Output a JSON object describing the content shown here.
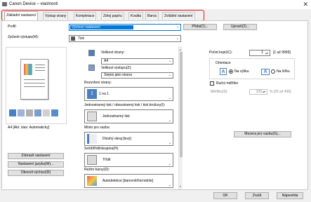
{
  "window": {
    "title": "Canon Device – vlastnosti",
    "close": "✕"
  },
  "tabs": [
    {
      "label": "Základní nastavení"
    },
    {
      "label": "Výstup strany"
    },
    {
      "label": "Kompletace"
    },
    {
      "label": "Zdroj papíru"
    },
    {
      "label": "Kvalita"
    },
    {
      "label": "Barva"
    },
    {
      "label": "Zvláštní nastavení"
    }
  ],
  "profile": {
    "label": "Profil:",
    "value": "Výchozí nastavení",
    "add_button": "Přidat(1)...",
    "edit_button": "Upravit(2)..."
  },
  "output_method": {
    "label": "Způsob výstupu(M):",
    "value": "Tisk"
  },
  "preview": {
    "caption": "A4 [Akt. stav: Automaticky]"
  },
  "left_buttons": {
    "show_settings": "Zobrazit nastavení",
    "language_settings": "Nastavení jazyka(W)...",
    "restore_defaults": "Obnovit výchozí(R)"
  },
  "page_size": {
    "label": "Velikost strany:",
    "value": "A4"
  },
  "output_size": {
    "label": "Velikost výstupu(Z):",
    "value": "Stejná jako strana"
  },
  "layout": {
    "label": "Rozvržení strany:",
    "value": "1 na 1"
  },
  "duplex": {
    "label": "Jednostranný tisk / oboustranný tisk / tisk brožury(I):",
    "value": "Jednostranný tisk"
  },
  "binding": {
    "label": "Místo pro vazbu:",
    "value": "Dlouhý okraj [levý]",
    "margin_button": "Mezera pro vazbu(G)..."
  },
  "collate": {
    "label": "Sešít/třídit/skupina(H):",
    "value": "Třídit"
  },
  "color_mode": {
    "label": "Režim barvy(D):",
    "value": "Autodetekce [barevně/černobíle]"
  },
  "copies": {
    "label": "Počet kopií(C):",
    "value": "1",
    "range": "[1 až 9999]"
  },
  "orientation": {
    "title": "Orientace",
    "portrait": "Na výšku",
    "landscape": "Na šířku",
    "portrait_letter": "A",
    "landscape_letter": "A"
  },
  "scaling": {
    "label": "Ruční měřítko",
    "sub_label": "Měřítko(S):",
    "value": "100",
    "range": "% [25 až 400]"
  },
  "footer": {
    "ok": "OK",
    "cancel": "Zrušit",
    "help": "Nápověda"
  }
}
